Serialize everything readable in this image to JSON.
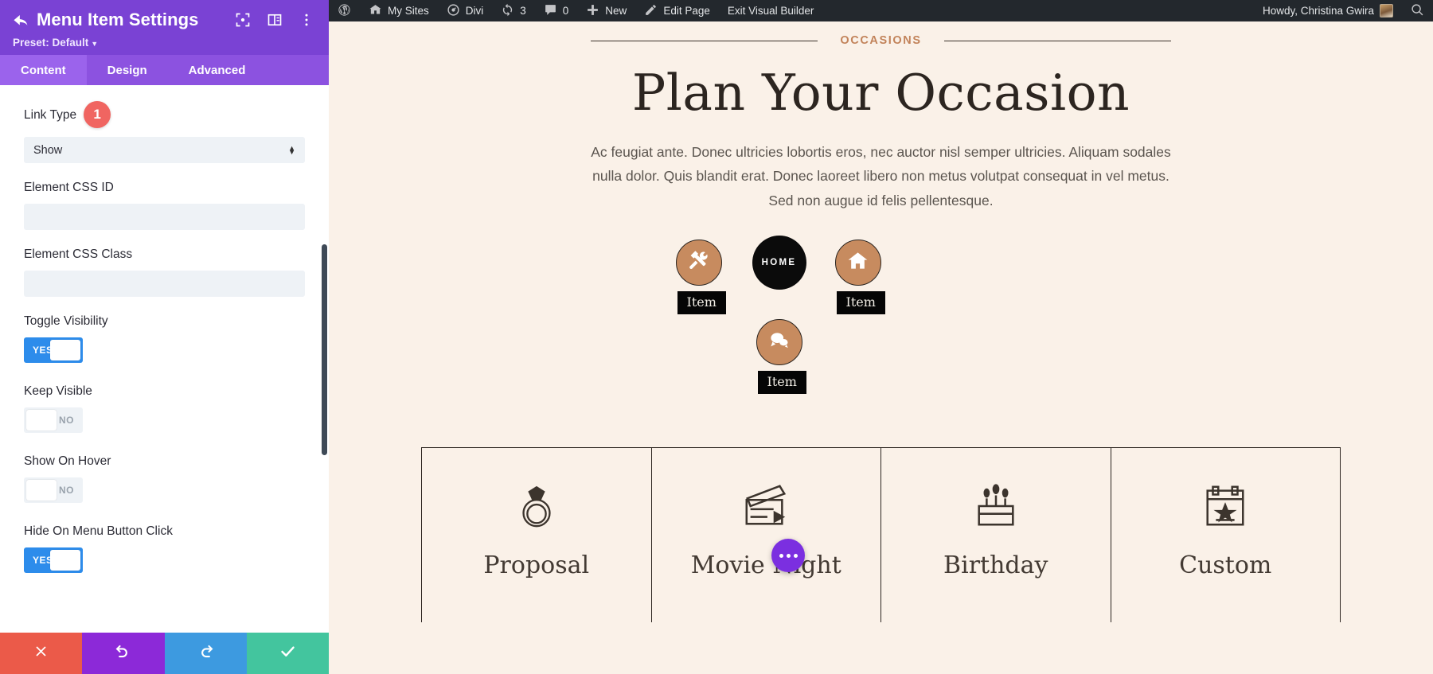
{
  "panel": {
    "title": "Menu Item Settings",
    "preset": "Preset: Default",
    "back_icon": "back-arrow-icon",
    "header_icons": [
      "focus-frame-icon",
      "layout-columns-icon",
      "kebab-menu-icon"
    ],
    "tabs": [
      {
        "label": "Content",
        "active": true
      },
      {
        "label": "Design",
        "active": false
      },
      {
        "label": "Advanced",
        "active": false
      }
    ],
    "fields": {
      "link_type": {
        "label": "Link Type",
        "value": "Show",
        "badge": "1",
        "badge_color": "#f06561"
      },
      "css_id": {
        "label": "Element CSS ID",
        "value": "",
        "placeholder": ""
      },
      "css_class": {
        "label": "Element CSS Class",
        "value": "",
        "placeholder": ""
      },
      "toggle_visibility": {
        "label": "Toggle Visibility",
        "value": "YES",
        "on": true
      },
      "keep_visible": {
        "label": "Keep Visible",
        "value": "NO",
        "on": false
      },
      "show_on_hover": {
        "label": "Show On Hover",
        "value": "NO",
        "on": false
      },
      "hide_on_menu_button_click": {
        "label": "Hide On Menu Button Click",
        "value": "YES",
        "on": true
      }
    },
    "footer": {
      "cancel": "cancel-icon",
      "undo": "undo-icon",
      "redo": "redo-icon",
      "save": "check-icon"
    },
    "colors": {
      "header": "#7a42d4",
      "tab_bar": "#8c52e0",
      "tab_active": "#9b63ec",
      "toggle_on": "#2d8ceb",
      "cancel": "#eb5a49",
      "undo": "#8c29d8",
      "redo": "#3d9ae0",
      "save": "#43c59e"
    }
  },
  "adminbar": {
    "items": [
      {
        "icon": "wordpress-logo-icon",
        "label": ""
      },
      {
        "icon": "sites-icon",
        "label": "My Sites"
      },
      {
        "icon": "divi-icon",
        "label": "Divi"
      },
      {
        "icon": "updates-icon",
        "label": "3"
      },
      {
        "icon": "comments-icon",
        "label": "0"
      },
      {
        "icon": "plus-icon",
        "label": "New"
      },
      {
        "icon": "pencil-icon",
        "label": "Edit Page"
      },
      {
        "icon": "",
        "label": "Exit Visual Builder"
      }
    ],
    "howdy": "Howdy, Christina Gwira",
    "avatar": "user-avatar",
    "search_icon": "search-icon",
    "background": "#23282d"
  },
  "page": {
    "eyebrow": "OCCASIONS",
    "title": "Plan Your Occasion",
    "paragraph": "Ac feugiat ante. Donec ultricies lobortis eros, nec auctor nisl semper ultricies. Aliquam sodales nulla dolor. Quis blandit erat. Donec laoreet libero non metus volutpat consequat in vel metus. Sed non augue id felis pellentesque.",
    "menu_items": [
      {
        "icon": "tools-icon",
        "style": "tan",
        "chip": "Item"
      },
      {
        "icon": "",
        "style": "dark",
        "label": "HOME",
        "chip": ""
      },
      {
        "icon": "home-icon",
        "style": "tan",
        "chip": "Item"
      },
      {
        "icon": "chat-bubbles-icon",
        "style": "tan",
        "chip": "Item"
      }
    ],
    "cards": [
      {
        "icon": "ring-icon",
        "label": "Proposal"
      },
      {
        "icon": "clapperboard-icon",
        "label": "Movie Night"
      },
      {
        "icon": "birthday-cake-icon",
        "label": "Birthday"
      },
      {
        "icon": "calendar-star-icon",
        "label": "Custom"
      }
    ],
    "fab": "more-options-icon",
    "colors": {
      "background": "#faf1e8",
      "eyebrow": "#c2835a",
      "heading": "#2c2520",
      "circle_tan": "#c78b5f",
      "circle_dark": "#0b0b0b",
      "fab": "#7b2fe0"
    }
  }
}
